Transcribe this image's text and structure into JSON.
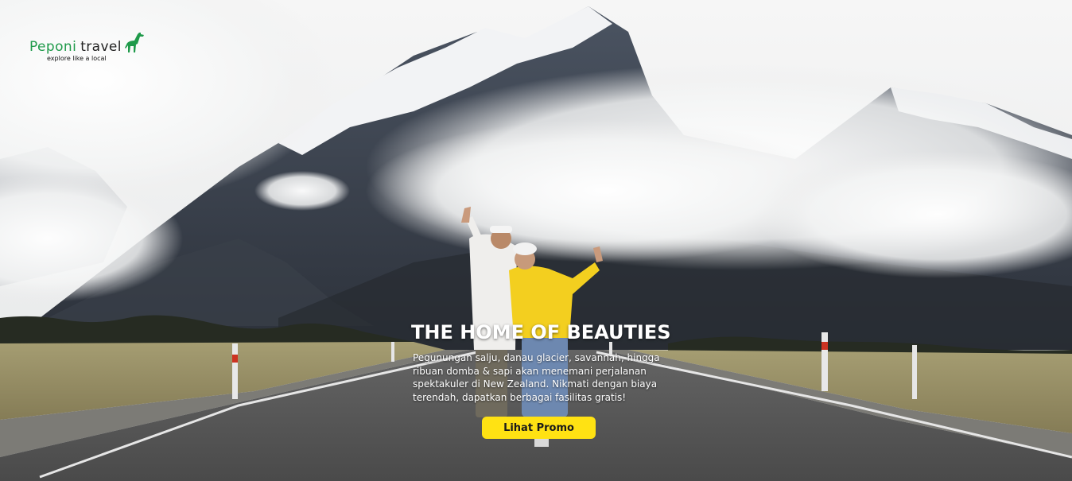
{
  "brand": {
    "name_part1": "Peponi",
    "name_part2": "travel",
    "tagline": "explore like a local",
    "logo_color": "#1f9a4a",
    "logo_icon": "giraffe-icon"
  },
  "hero": {
    "headline": "THE HOME OF BEAUTIES",
    "description": "Pegunungan salju, danau glacier, savannah, hingga ribuan domba & sapi akan menemani perjalanan spektakuler di New Zealand. Nikmati dengan biaya terendah, dapatkan berbagai fasilitas gratis!",
    "cta_label": "Lihat Promo",
    "cta_color": "#ffe213"
  }
}
